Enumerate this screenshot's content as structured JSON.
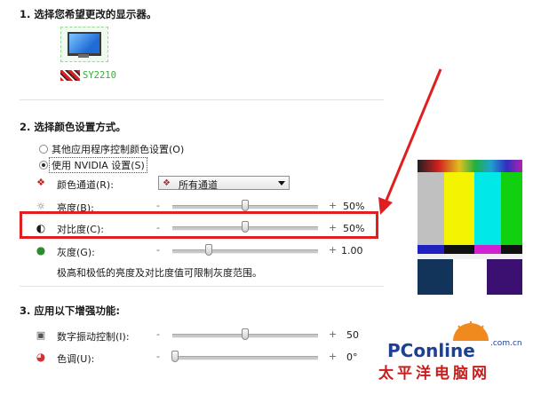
{
  "section1": {
    "title": "1. 选择您希望更改的显示器。",
    "monitor_name": "SY2210"
  },
  "section2": {
    "title": "2. 选择颜色设置方式。",
    "radio_other": "其他应用程序控制颜色设置(O)",
    "radio_nvidia": "使用 NVIDIA 设置(S)",
    "channel_label": "颜色通道(R):",
    "channel_value": "所有通道",
    "brightness": {
      "label": "亮度(B):",
      "minus": "-",
      "plus": "+",
      "value": "50%",
      "level": 0.5
    },
    "contrast": {
      "label": "对比度(C):",
      "minus": "-",
      "plus": "+",
      "value": "50%",
      "level": 0.5
    },
    "gamma": {
      "label": "灰度(G):",
      "minus": "-",
      "plus": "+",
      "value": "1.00",
      "level": 0.25
    },
    "note": "极高和极低的亮度及对比度值可限制灰度范围。"
  },
  "section3": {
    "title": "3. 应用以下增强功能:",
    "vibrance": {
      "label": "数字振动控制(I):",
      "minus": "-",
      "plus": "+",
      "value": "50",
      "level": 0.5
    },
    "hue": {
      "label": "色调(U):",
      "minus": "-",
      "plus": "+",
      "value": "0°",
      "level": 0.02
    }
  },
  "watermark": {
    "main": "PConline",
    "sub": "太平洋电脑网",
    "suffix": ".com.cn"
  },
  "colors": {
    "highlight": "#e02020",
    "arrow": "#e02020",
    "brand_blue": "#1d3f94",
    "brand_red": "#c81e1e"
  },
  "icons": {
    "monitor": "monitor-icon",
    "channel": "color-channel-icon",
    "brightness": "sun-icon",
    "contrast": "contrast-icon",
    "gamma": "gamma-icon",
    "vibrance": "vibrance-icon",
    "hue": "hue-icon"
  }
}
